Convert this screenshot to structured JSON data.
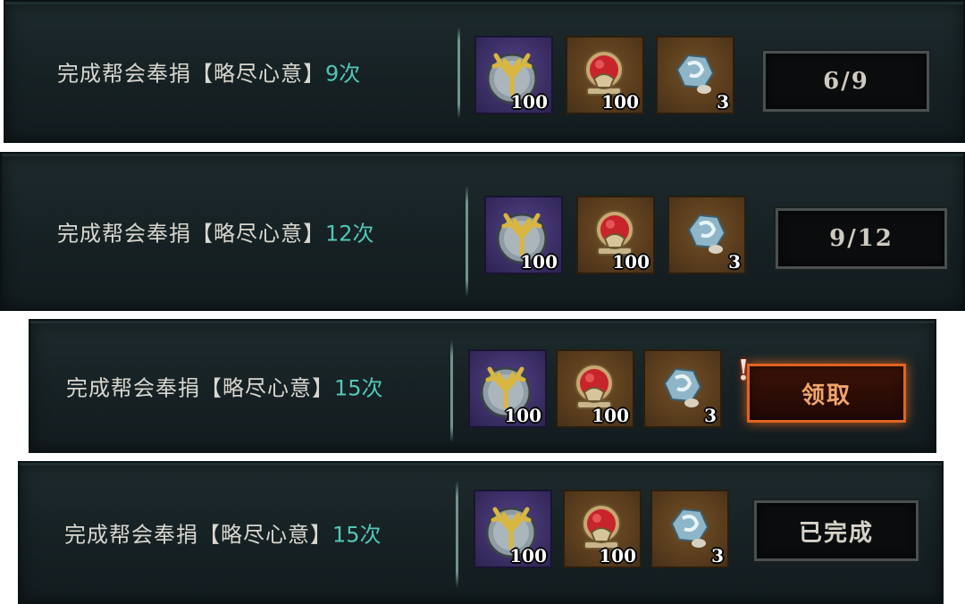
{
  "tasks": [
    {
      "label": "完成帮会奉捐【略尽心意】",
      "count": "9次",
      "rewards": [
        {
          "icon": "antler-medal-icon",
          "qty": "100"
        },
        {
          "icon": "red-lion-emblem-icon",
          "qty": "100"
        },
        {
          "icon": "blue-gem-ore-icon",
          "qty": "3"
        }
      ],
      "button": "6/9",
      "state": "progress"
    },
    {
      "label": "完成帮会奉捐【略尽心意】",
      "count": "12次",
      "rewards": [
        {
          "icon": "antler-medal-icon",
          "qty": "100"
        },
        {
          "icon": "red-lion-emblem-icon",
          "qty": "100"
        },
        {
          "icon": "blue-gem-ore-icon",
          "qty": "3"
        }
      ],
      "button": "9/12",
      "state": "progress"
    },
    {
      "label": "完成帮会奉捐【略尽心意】",
      "count": "15次",
      "rewards": [
        {
          "icon": "antler-medal-icon",
          "qty": "100"
        },
        {
          "icon": "red-lion-emblem-icon",
          "qty": "100"
        },
        {
          "icon": "blue-gem-ore-icon",
          "qty": "3"
        }
      ],
      "button": "领取",
      "state": "claimable",
      "alert": "!"
    },
    {
      "label": "完成帮会奉捐【略尽心意】",
      "count": "15次",
      "rewards": [
        {
          "icon": "antler-medal-icon",
          "qty": "100"
        },
        {
          "icon": "red-lion-emblem-icon",
          "qty": "100"
        },
        {
          "icon": "blue-gem-ore-icon",
          "qty": "3"
        }
      ],
      "button": "已完成",
      "state": "completed"
    }
  ],
  "colors": {
    "panel": "#1a2628",
    "count_text": "#52c7b8",
    "claim_border": "#e0641e",
    "reward_purple": "#3c2f66",
    "reward_gold": "#5a3d1c"
  }
}
